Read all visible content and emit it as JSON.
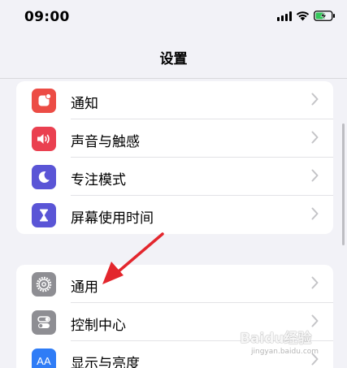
{
  "status_bar": {
    "time": "09:00",
    "icons": [
      "cellular-signal-icon",
      "wifi-icon",
      "battery-charging-icon"
    ]
  },
  "nav": {
    "title": "设置"
  },
  "groups": [
    {
      "items": [
        {
          "label": "通知",
          "icon": "notification-bell-icon",
          "icon_color": "#ec4c45"
        },
        {
          "label": "声音与触感",
          "icon": "speaker-icon",
          "icon_color": "#ea4050"
        },
        {
          "label": "专注模式",
          "icon": "moon-icon",
          "icon_color": "#5a55d6"
        },
        {
          "label": "屏幕使用时间",
          "icon": "hourglass-icon",
          "icon_color": "#5a55d6"
        }
      ]
    },
    {
      "items": [
        {
          "label": "通用",
          "icon": "gear-icon",
          "icon_color": "#8e8e93"
        },
        {
          "label": "控制中心",
          "icon": "toggle-switches-icon",
          "icon_color": "#8e8e93"
        },
        {
          "label": "显示与亮度",
          "icon": "text-size-icon",
          "icon_color": "#2f7cf6",
          "icon_text": "AA"
        }
      ]
    }
  ],
  "annotation": {
    "arrow_color": "#e3262d",
    "points_to": "通用"
  },
  "watermark": {
    "text": "Baidu经验",
    "url_text": "jingyan.baidu.com"
  },
  "colors": {
    "background": "#f2f2f7",
    "card": "#ffffff",
    "chevron": "#c4c4c7"
  }
}
